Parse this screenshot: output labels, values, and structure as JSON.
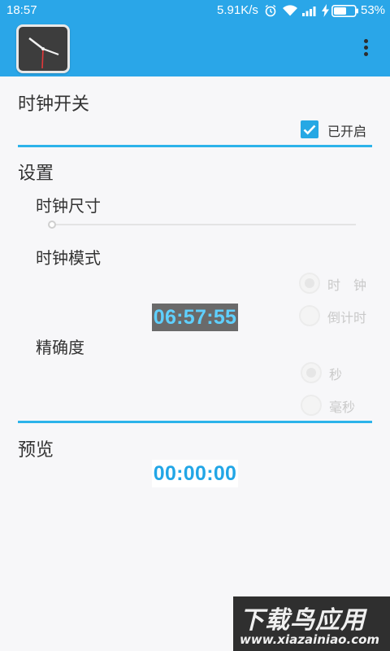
{
  "status_bar": {
    "time": "18:57",
    "network_speed": "5.91K/s",
    "battery_percent": "53%",
    "icons": [
      "alarm-icon",
      "wifi-icon",
      "signal-icon",
      "charging-icon",
      "battery-icon"
    ]
  },
  "app_bar": {
    "color": "#2aa6e8",
    "app_icon": "clock-icon",
    "menu_icon": "overflow-menu-icon"
  },
  "clock_switch": {
    "title": "时钟开关",
    "checkbox_label": "已开启",
    "checked": true
  },
  "settings": {
    "title": "设置",
    "clock_size": {
      "label": "时钟尺寸",
      "value": 0
    },
    "clock_mode": {
      "label": "时钟模式",
      "options": [
        "时　钟",
        "倒计时"
      ],
      "selected": "时　钟"
    },
    "clock_display": "06:57:55",
    "precision": {
      "label": "精确度",
      "options": [
        "秒",
        "毫秒"
      ],
      "selected": "秒"
    }
  },
  "preview": {
    "title": "预览",
    "display": "00:00:00"
  },
  "watermark": {
    "title": "下载鸟应用",
    "url": "www.xiazainiao.com"
  },
  "colors": {
    "accent": "#2cb3ea",
    "display_text": "#5fd0ff",
    "preview_text": "#22a6e6"
  }
}
